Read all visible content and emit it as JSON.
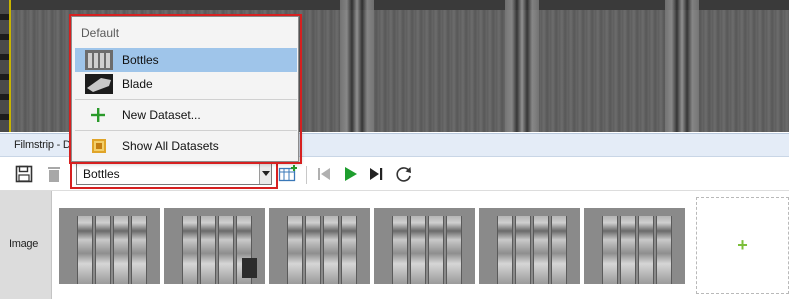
{
  "filmstrip": {
    "header_title": "Filmstrip - De"
  },
  "toolbar": {
    "dataset_value": "Bottles"
  },
  "dropdown": {
    "group_label": "Default",
    "items": [
      {
        "label": "Bottles",
        "icon": "bottles-thumbnail-icon",
        "selected": true
      },
      {
        "label": "Blade",
        "icon": "blade-thumbnail-icon",
        "selected": false
      },
      {
        "label": "New Dataset...",
        "icon": "plus-icon",
        "selected": false
      },
      {
        "label": "Show All Datasets",
        "icon": "datasets-icon",
        "selected": false
      }
    ]
  },
  "strip": {
    "row_label": "Image",
    "add_label": "+"
  },
  "colors": {
    "highlight_border": "#d62020",
    "selection": "#9fc5ea",
    "play_green": "#1e9e2e",
    "add_green": "#7cbf3a"
  }
}
